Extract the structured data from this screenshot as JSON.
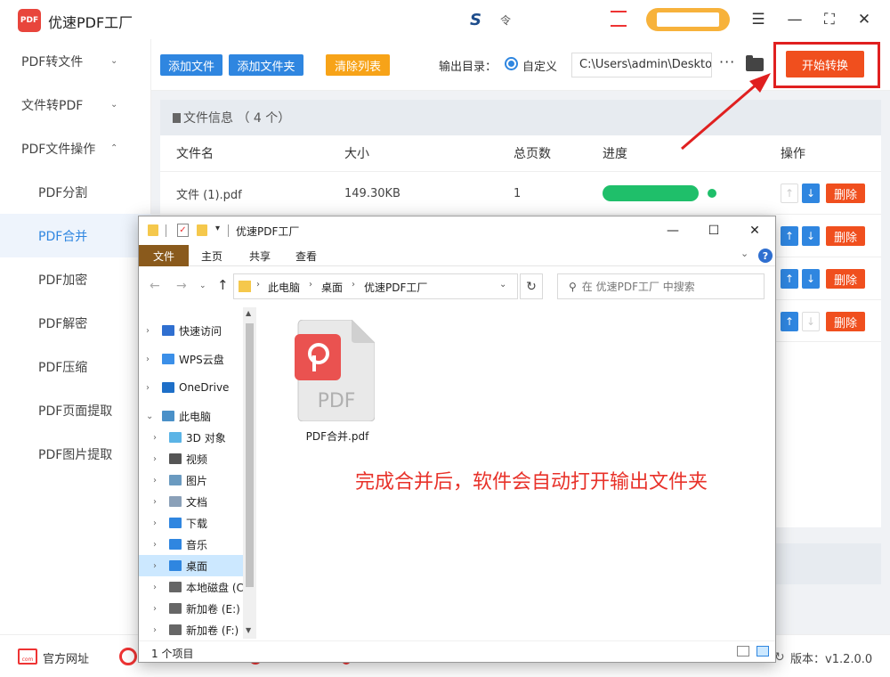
{
  "app": {
    "title": "优速PDF工厂",
    "logo_text": "PDF",
    "center_logo": "S",
    "center_extra": "令"
  },
  "window_controls": {
    "menu_icon": "menu-icon",
    "minimize_icon": "minimize-icon",
    "maximize_icon": "maximize-icon",
    "close_icon": "close-icon"
  },
  "sidebar": {
    "items": [
      {
        "label": "PDF转文件",
        "chevron": "⌄"
      },
      {
        "label": "文件转PDF",
        "chevron": "⌄"
      },
      {
        "label": "PDF文件操作",
        "chevron": "⌃"
      },
      {
        "label": "PDF分割"
      },
      {
        "label": "PDF合并"
      },
      {
        "label": "PDF加密"
      },
      {
        "label": "PDF解密"
      },
      {
        "label": "PDF压缩"
      },
      {
        "label": "PDF页面提取"
      },
      {
        "label": "PDF图片提取"
      }
    ]
  },
  "toolbar": {
    "add_file": "添加文件",
    "add_folder": "添加文件夹",
    "clear_list": "清除列表",
    "output_label": "输出目录：",
    "custom_label": "自定义",
    "output_path": "C:\\Users\\admin\\Deskto",
    "more": "···",
    "start": "开始转换"
  },
  "file_panel": {
    "header": "文件信息 （ 4 个）",
    "columns": [
      "文件名",
      "大小",
      "总页数",
      "进度",
      "操作"
    ],
    "rows": [
      {
        "name": "文件 (1).pdf",
        "size": "149.30KB",
        "pages": "1",
        "progress": 1.0,
        "delete": "删除"
      },
      {
        "delete": "删除"
      },
      {
        "delete": "删除"
      },
      {
        "delete": "删除"
      }
    ]
  },
  "statusbar": {
    "website": "官方网址",
    "website_icon_text": "com",
    "version": "版本：v1.2.0.0"
  },
  "explorer": {
    "title": "优速PDF工厂",
    "check_mark": "✓",
    "tabs": [
      "文件",
      "主页",
      "共享",
      "查看"
    ],
    "breadcrumb": [
      "此电脑",
      "桌面",
      "优速PDF工厂"
    ],
    "search_placeholder": "在 优速PDF工厂 中搜索",
    "tree": [
      {
        "label": "快速访问",
        "icon_color": "#2f6fd0"
      },
      {
        "label": "WPS云盘",
        "icon_color": "#3b8fe8"
      },
      {
        "label": "OneDrive",
        "icon_color": "#1e6fc8"
      },
      {
        "label": "此电脑",
        "icon_color": "#4a90c8"
      },
      {
        "label": "3D 对象",
        "icon_color": "#5bb4e6"
      },
      {
        "label": "视频",
        "icon_color": "#555555"
      },
      {
        "label": "图片",
        "icon_color": "#6a9ac0"
      },
      {
        "label": "文档",
        "icon_color": "#8aa0b8"
      },
      {
        "label": "下载",
        "icon_color": "#2f86e0"
      },
      {
        "label": "音乐",
        "icon_color": "#2f86e0"
      },
      {
        "label": "桌面",
        "icon_color": "#2f86e0"
      },
      {
        "label": "本地磁盘 (C",
        "icon_color": "#666666"
      },
      {
        "label": "新加卷 (E:)",
        "icon_color": "#666666"
      },
      {
        "label": "新加卷 (F:)",
        "icon_color": "#666666"
      }
    ],
    "file_name": "PDF合并.pdf",
    "pdf_label": "PDF",
    "status": "1 个项目",
    "help": "?"
  },
  "annotation": {
    "text": "完成合并后，软件会自动打开输出文件夹"
  },
  "colors": {
    "accent_blue": "#2f86e0",
    "accent_orange": "#f7a318",
    "start_red": "#f04f1e",
    "progress_green": "#1fbf6a",
    "annotation_red": "#e8322a"
  }
}
